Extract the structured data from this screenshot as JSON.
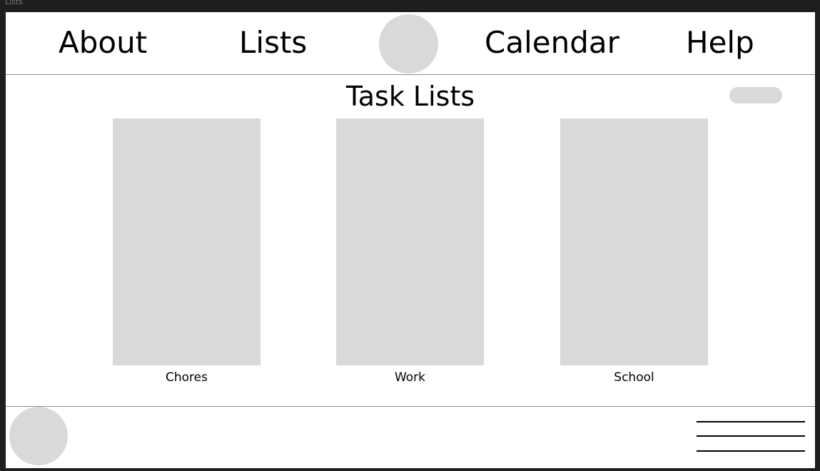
{
  "window": {
    "title": "Lists"
  },
  "nav": {
    "items": [
      {
        "label": "About"
      },
      {
        "label": "Lists"
      },
      {
        "label": "Calendar"
      },
      {
        "label": "Help"
      }
    ],
    "logo_icon": "circle-logo-icon"
  },
  "main": {
    "title": "Task Lists",
    "action_button_icon": "pill-button",
    "lists": [
      {
        "label": "Chores"
      },
      {
        "label": "Work"
      },
      {
        "label": "School"
      }
    ]
  },
  "footer": {
    "avatar_icon": "avatar-circle-icon",
    "menu_icon": "hamburger-menu-icon"
  },
  "colors": {
    "background": "#1e1e1e",
    "frame": "#ffffff",
    "placeholder": "#d9d9d9",
    "divider": "#8c8c8c"
  }
}
